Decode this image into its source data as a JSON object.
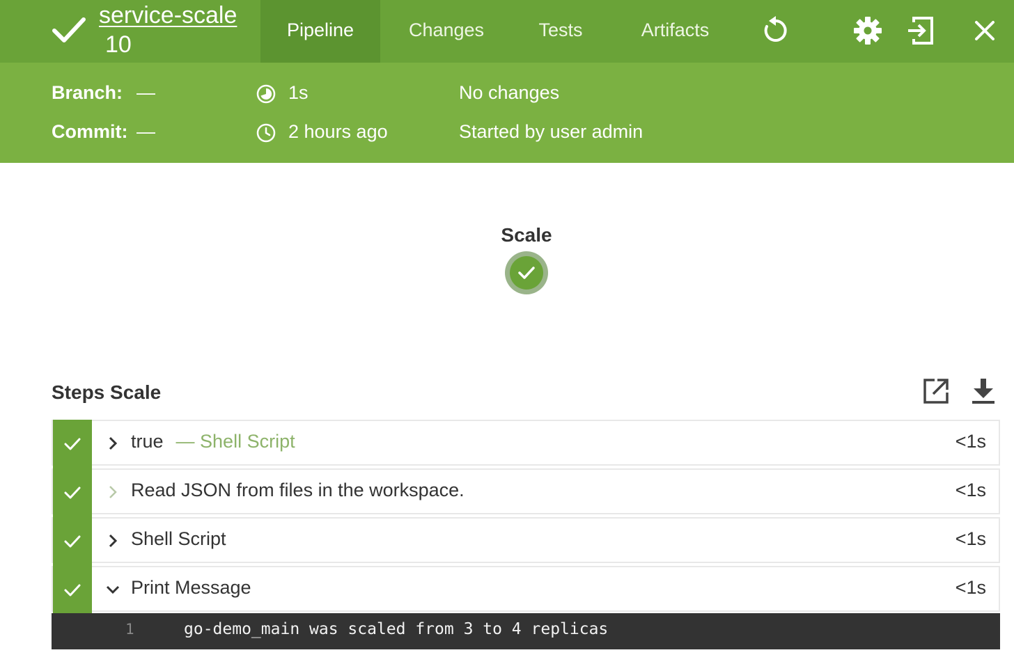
{
  "header": {
    "run_name": "service-scale",
    "run_number": "10",
    "tabs": [
      {
        "label": "Pipeline",
        "active": true
      },
      {
        "label": "Changes",
        "active": false
      },
      {
        "label": "Tests",
        "active": false
      },
      {
        "label": "Artifacts",
        "active": false
      }
    ],
    "icons": [
      "checkmark-icon",
      "rerun-icon",
      "gear-icon",
      "exit-icon",
      "close-icon"
    ]
  },
  "summary": {
    "branch_label": "Branch:",
    "branch_value": "—",
    "commit_label": "Commit:",
    "commit_value": "—",
    "duration": "1s",
    "started": "2 hours ago",
    "changes": "No changes",
    "started_by": "Started by user admin"
  },
  "stage": {
    "name": "Scale",
    "status": "success"
  },
  "steps": {
    "title": "Steps Scale",
    "items": [
      {
        "title": "true",
        "subtitle": "— Shell Script",
        "duration": "<1s",
        "expanded": false
      },
      {
        "title": "Read JSON from files in the workspace.",
        "subtitle": "",
        "duration": "<1s",
        "expanded": false
      },
      {
        "title": "Shell Script",
        "subtitle": "",
        "duration": "<1s",
        "expanded": false
      },
      {
        "title": "Print Message",
        "subtitle": "",
        "duration": "<1s",
        "expanded": true
      }
    ],
    "log": {
      "line_no": "1",
      "text": "go-demo_main was scaled from 3 to 4 replicas"
    }
  },
  "colors": {
    "topbar": "#6aa338",
    "summary": "#7bb142",
    "active_tab": "#5c9430",
    "log_bg": "#333333"
  }
}
